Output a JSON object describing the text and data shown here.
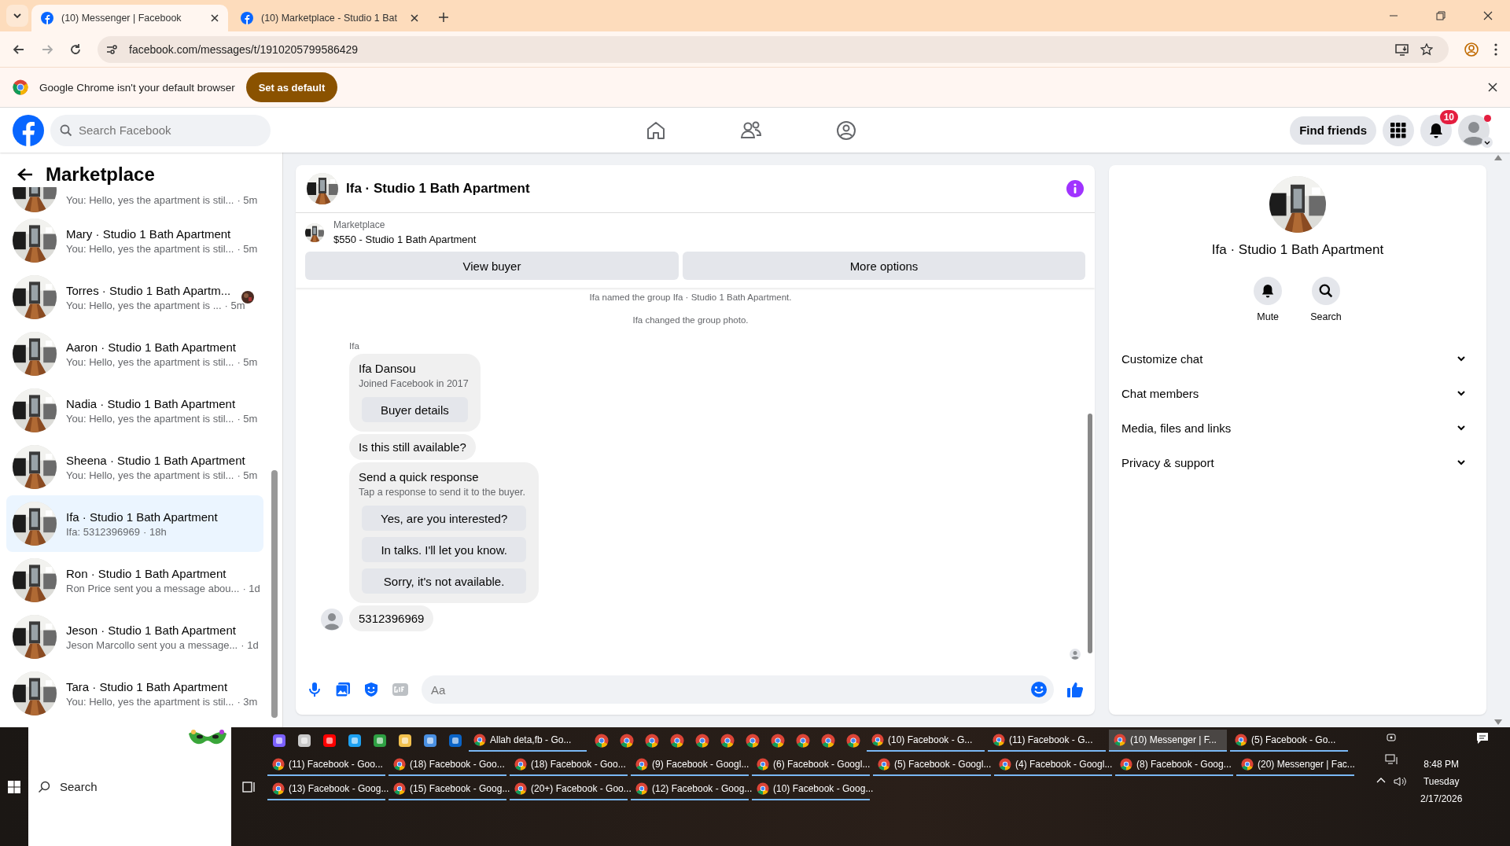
{
  "browser": {
    "tabs": [
      {
        "title": "(10) Messenger | Facebook",
        "selected": true
      },
      {
        "title": "(10) Marketplace - Studio 1 Bat",
        "selected": false
      }
    ],
    "url": "facebook.com/messages/t/1910205799586429",
    "infobar": {
      "text": "Google Chrome isn't your default browser",
      "button": "Set as default"
    }
  },
  "header": {
    "search_placeholder": "Search Facebook",
    "find_friends": "Find friends",
    "notifications_badge": "10"
  },
  "sidebar": {
    "title": "Marketplace",
    "conversations": [
      {
        "preview": "You: Hello, yes the apartment is stil...",
        "time": "· 5m",
        "selected": false,
        "seen": false
      },
      {
        "name": "Mary · Studio 1 Bath Apartment",
        "preview": "You: Hello, yes the apartment is stil...",
        "time": "· 5m",
        "selected": false,
        "seen": false
      },
      {
        "name": "Torres · Studio 1 Bath Apartm...",
        "preview": "You: Hello, yes the apartment is ...",
        "time": "· 5m",
        "selected": false,
        "seen": true
      },
      {
        "name": "Aaron · Studio 1 Bath Apartment",
        "preview": "You: Hello, yes the apartment is stil...",
        "time": "· 5m",
        "selected": false,
        "seen": false
      },
      {
        "name": "Nadia · Studio 1 Bath Apartment",
        "preview": "You: Hello, yes the apartment is stil...",
        "time": "· 5m",
        "selected": false,
        "seen": false
      },
      {
        "name": "Sheena · Studio 1 Bath Apartment",
        "preview": "You: Hello, yes the apartment is stil...",
        "time": "· 5m",
        "selected": false,
        "seen": false
      },
      {
        "name": "Ifa · Studio 1 Bath Apartment",
        "preview": "Ifa: 5312396969",
        "time": "· 18h",
        "selected": true,
        "seen": false
      },
      {
        "name": "Ron · Studio 1 Bath Apartment",
        "preview": "Ron Price sent you a message abou...",
        "time": "· 1d",
        "selected": false,
        "seen": false
      },
      {
        "name": "Jeson · Studio 1 Bath Apartment",
        "preview": "Jeson Marcollo sent you a message...",
        "time": "· 1d",
        "selected": false,
        "seen": false
      },
      {
        "name": "Tara · Studio 1 Bath Apartment",
        "preview": "You: Hello, yes the apartment is stil...",
        "time": "· 3m",
        "selected": false,
        "seen": false
      }
    ]
  },
  "chat": {
    "title": "Ifa · Studio 1 Bath Apartment",
    "listing": {
      "source": "Marketplace",
      "title": "$550 - Studio 1 Bath Apartment"
    },
    "actions": [
      "View buyer",
      "More options"
    ],
    "messages": [
      {
        "kind": "notice",
        "text": "Ifa named the group Ifa · Studio 1 Bath Apartment."
      },
      {
        "kind": "notice",
        "text": "Ifa changed the group photo."
      },
      {
        "kind": "sender",
        "text": "Ifa"
      },
      {
        "kind": "profile",
        "name": "Ifa Dansou",
        "subtitle": "Joined Facebook in 2017",
        "button": "Buyer details"
      },
      {
        "kind": "text",
        "text": "Is this still available?",
        "avatar": false
      },
      {
        "kind": "quick",
        "title": "Send a quick response",
        "subtitle": "Tap a response to send it to the buyer.",
        "options": [
          "Yes, are you interested?",
          "In talks. I'll let you know.",
          "Sorry, it's not available."
        ]
      },
      {
        "kind": "text",
        "text": "5312396969",
        "avatar": true
      }
    ],
    "composer_placeholder": "Aa"
  },
  "details": {
    "title": "Ifa · Studio 1 Bath Apartment",
    "actions": [
      "Mute",
      "Search"
    ],
    "sections": [
      {
        "label": "Customize chat",
        "expanded": false
      },
      {
        "label": "Chat members",
        "expanded": false
      },
      {
        "label": "Media, files and links",
        "expanded": false
      },
      {
        "label": "Privacy & support",
        "expanded": false
      }
    ]
  },
  "taskbar": {
    "search_placeholder": "Search",
    "items": [
      {
        "kind": "icon"
      },
      {
        "kind": "icon"
      },
      {
        "kind": "icon"
      },
      {
        "kind": "icon"
      },
      {
        "kind": "icon"
      },
      {
        "kind": "icon"
      },
      {
        "kind": "icon"
      },
      {
        "kind": "icon"
      },
      {
        "kind": "window",
        "label": "Allah deta,fb - Go...",
        "selected": false
      },
      {
        "kind": "icon"
      },
      {
        "kind": "icon"
      },
      {
        "kind": "icon"
      },
      {
        "kind": "icon"
      },
      {
        "kind": "icon"
      },
      {
        "kind": "icon"
      },
      {
        "kind": "icon"
      },
      {
        "kind": "icon"
      },
      {
        "kind": "icon"
      },
      {
        "kind": "icon"
      },
      {
        "kind": "icon"
      },
      {
        "kind": "window",
        "label": "(10) Facebook - G...",
        "selected": false
      },
      {
        "kind": "window",
        "label": "(11) Facebook - G...",
        "selected": false
      },
      {
        "kind": "window",
        "label": "(10) Messenger | F...",
        "selected": true
      },
      {
        "kind": "window",
        "label": "(5) Facebook - Go...",
        "selected": false
      },
      {
        "kind": "window",
        "label": "(11) Facebook - Goo...",
        "selected": false
      },
      {
        "kind": "window",
        "label": "(18) Facebook - Goo...",
        "selected": false
      },
      {
        "kind": "window",
        "label": "(18) Facebook - Goo...",
        "selected": false
      },
      {
        "kind": "window",
        "label": "(9) Facebook - Googl...",
        "selected": false
      },
      {
        "kind": "window",
        "label": "(6) Facebook - Googl...",
        "selected": false
      },
      {
        "kind": "window",
        "label": "(5) Facebook - Googl...",
        "selected": false
      },
      {
        "kind": "window",
        "label": "(4) Facebook - Googl...",
        "selected": false
      },
      {
        "kind": "window",
        "label": "(8) Facebook - Goog...",
        "selected": false
      },
      {
        "kind": "window",
        "label": "(20) Messenger | Fac...",
        "selected": false
      },
      {
        "kind": "window",
        "label": "(13) Facebook - Goog...",
        "selected": false
      },
      {
        "kind": "window",
        "label": "(15) Facebook - Goog...",
        "selected": false
      },
      {
        "kind": "window",
        "label": "(20+) Facebook - Goo...",
        "selected": false
      },
      {
        "kind": "window",
        "label": "(12) Facebook - Goog...",
        "selected": false
      },
      {
        "kind": "window",
        "label": "(10) Facebook - Goog...",
        "selected": false
      }
    ],
    "clock": {
      "time": "8:48 PM",
      "day": "Tuesday",
      "date": "2/17/2026"
    }
  }
}
